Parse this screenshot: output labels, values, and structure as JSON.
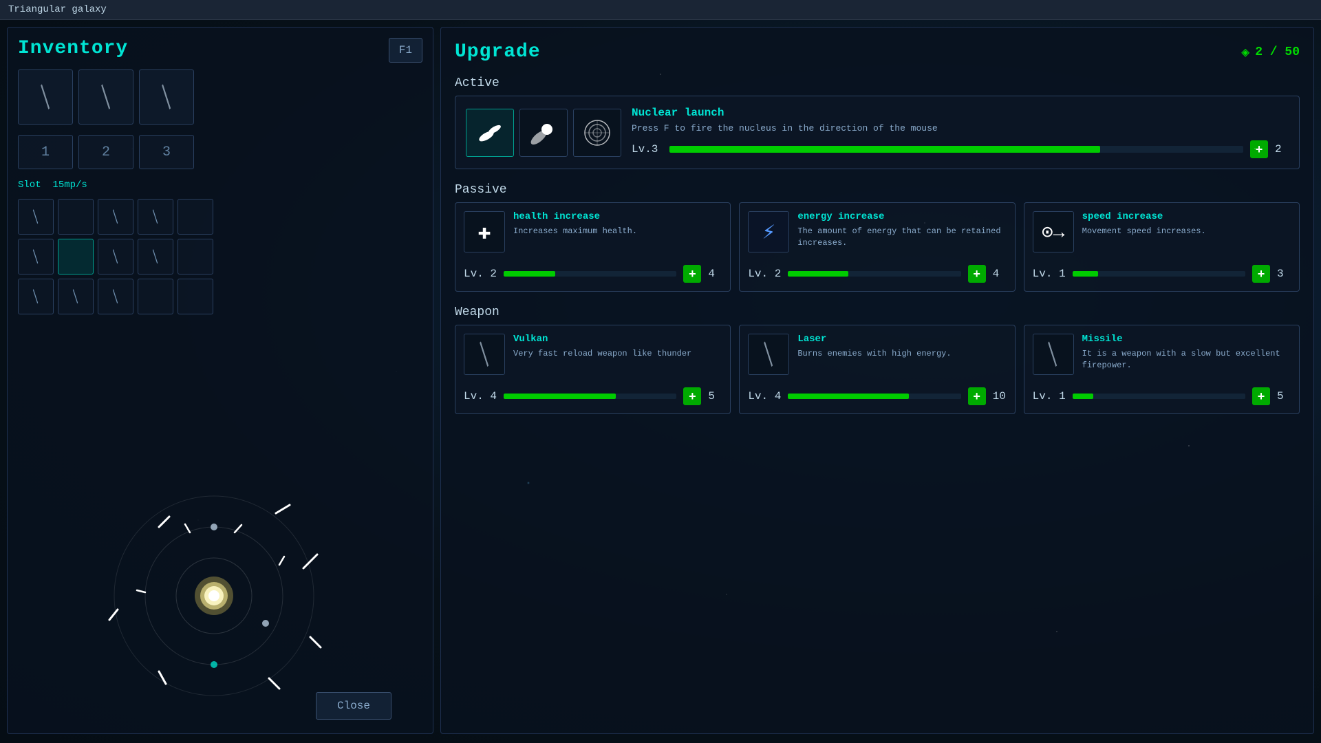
{
  "titleBar": {
    "title": "Triangular galaxy"
  },
  "leftPanel": {
    "inventoryTitle": "Inventory",
    "f1Badge": "F1",
    "weaponSlots": [
      {
        "hasWeapon": true
      },
      {
        "hasWeapon": true
      },
      {
        "hasWeapon": true
      }
    ],
    "slotNumbers": [
      "1",
      "2",
      "3"
    ],
    "slotLabel": "Slot",
    "slotRate": "15mp/s",
    "inventoryRows": [
      [
        {
          "hasItem": true,
          "selected": false
        },
        {
          "hasItem": false,
          "selected": false
        },
        {
          "hasItem": true,
          "selected": false
        },
        {
          "hasItem": true,
          "selected": false
        },
        {
          "hasItem": false,
          "selected": false
        }
      ],
      [
        {
          "hasItem": true,
          "selected": false
        },
        {
          "hasItem": false,
          "selected": true
        },
        {
          "hasItem": true,
          "selected": false
        },
        {
          "hasItem": true,
          "selected": false
        },
        {
          "hasItem": false,
          "selected": false
        }
      ],
      [
        {
          "hasItem": true,
          "selected": false
        },
        {
          "hasItem": true,
          "selected": false
        },
        {
          "hasItem": true,
          "selected": false
        },
        {
          "hasItem": false,
          "selected": false
        },
        {
          "hasItem": false,
          "selected": false
        }
      ]
    ],
    "closeButton": "Close"
  },
  "rightPanel": {
    "upgradeTitle": "Upgrade",
    "currency": {
      "icon": "◈",
      "value": "2 / 50"
    },
    "sections": {
      "active": {
        "label": "Active",
        "card": {
          "name": "Nuclear launch",
          "description": "Press F to fire the nucleus in the direction of the mouse",
          "level": "Lv.3",
          "progressPercent": 75,
          "cost": 2
        }
      },
      "passive": {
        "label": "Passive",
        "cards": [
          {
            "name": "health increase",
            "description": "Increases maximum health.",
            "iconType": "health",
            "level": "Lv. 2",
            "progressPercent": 30,
            "cost": 4
          },
          {
            "name": "energy increase",
            "description": "The amount of energy that can be retained increases.",
            "iconType": "energy",
            "level": "Lv. 2",
            "progressPercent": 35,
            "cost": 4
          },
          {
            "name": "speed increase",
            "description": "Movement speed increases.",
            "iconType": "speed",
            "level": "Lv. 1",
            "progressPercent": 15,
            "cost": 3
          }
        ]
      },
      "weapon": {
        "label": "Weapon",
        "cards": [
          {
            "name": "Vulkan",
            "description": "Very fast reload weapon like thunder",
            "level": "Lv. 4",
            "progressPercent": 65,
            "cost": 5
          },
          {
            "name": "Laser",
            "description": "Burns enemies with high energy.",
            "level": "Lv. 4",
            "progressPercent": 70,
            "cost": 10
          },
          {
            "name": "Missile",
            "description": "It is a weapon with a slow but excellent firepower.",
            "level": "Lv. 1",
            "progressPercent": 12,
            "cost": 5
          }
        ]
      }
    }
  }
}
